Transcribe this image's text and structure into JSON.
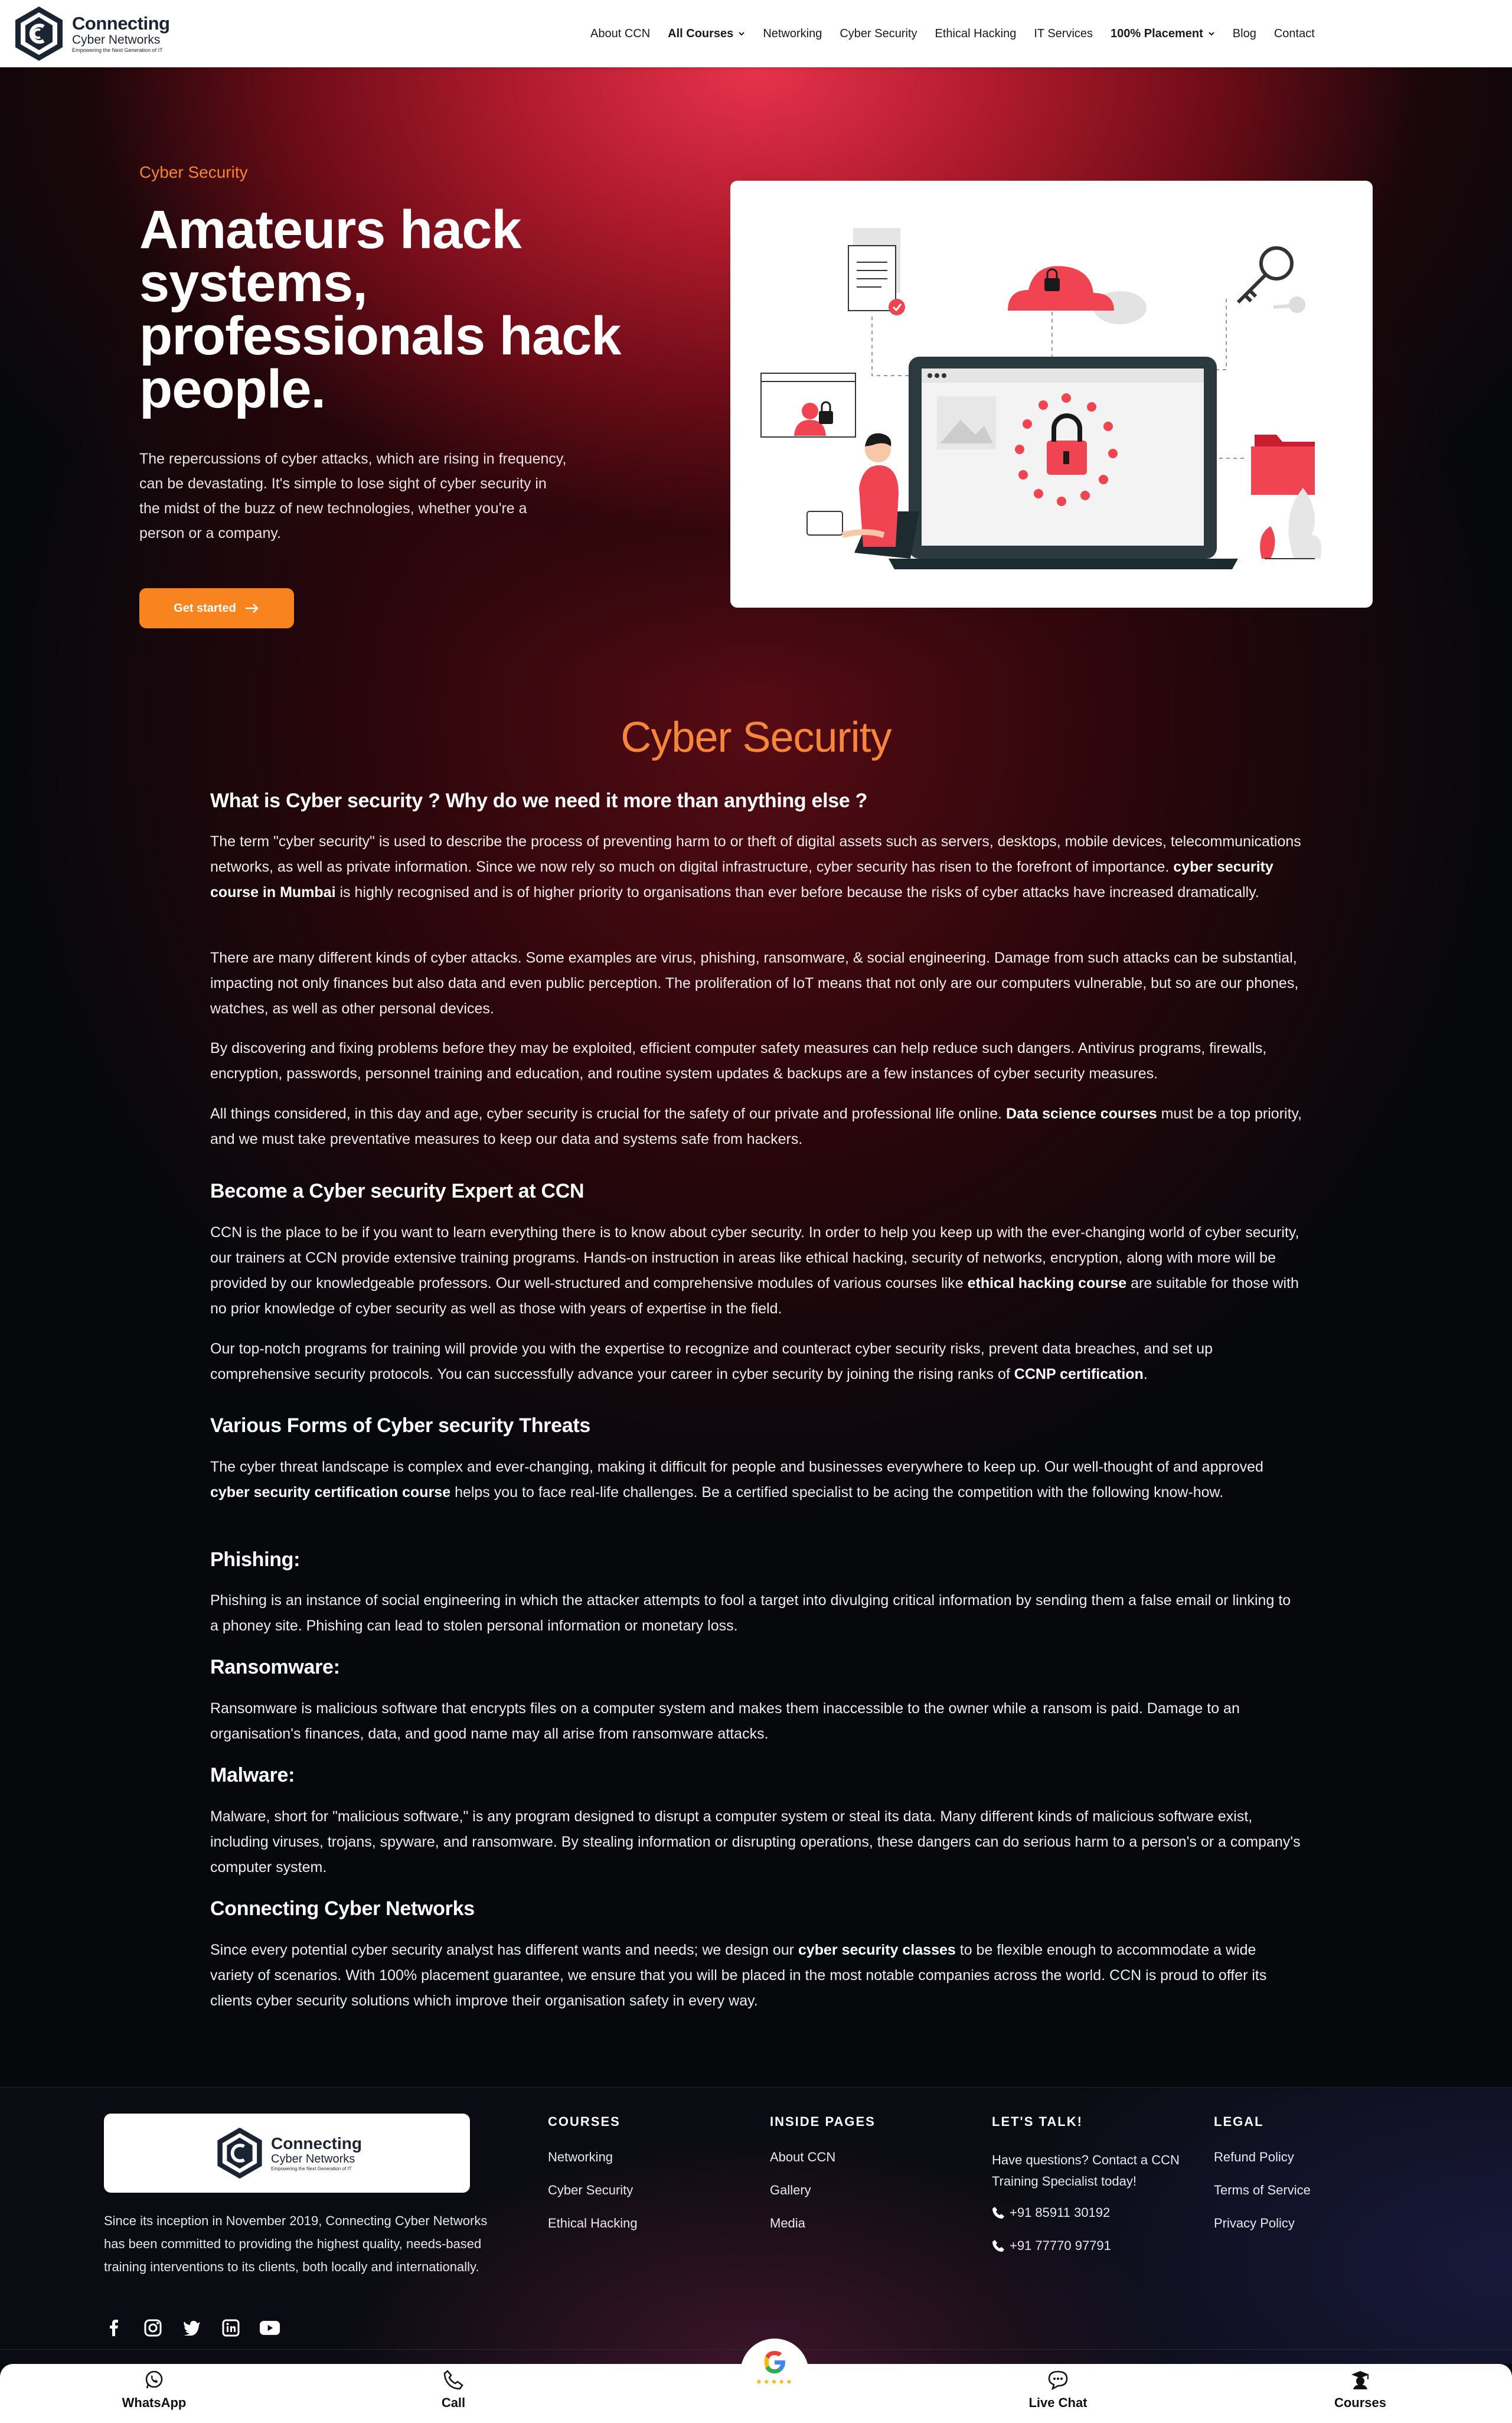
{
  "brand": {
    "title": "Connecting",
    "subtitle": "Cyber Networks",
    "tagline": "Empowering the Next Generation of IT"
  },
  "nav": {
    "items": [
      {
        "label": "About CCN"
      },
      {
        "label": "All Courses"
      },
      {
        "label": "Networking"
      },
      {
        "label": "Cyber Security"
      },
      {
        "label": "Ethical Hacking"
      },
      {
        "label": "IT Services"
      },
      {
        "label": "100% Placement"
      },
      {
        "label": "Blog"
      },
      {
        "label": "Contact"
      }
    ]
  },
  "hero": {
    "eyebrow": "Cyber Security",
    "title": "Amateurs hack systems, professionals hack people.",
    "text": "The repercussions of cyber attacks, which are rising in frequency, can be devastating. It's simple to lose sight of cyber security in the midst of the buzz of new technologies, whether you're a person or a company.",
    "cta": "Get started"
  },
  "article": {
    "title": "Cyber Security",
    "h_what": "What is Cyber security ? Why do we need it more than anything else ?",
    "p1a": "The term \"cyber security\" is used to describe the process of preventing harm to or theft of digital assets such as servers, desktops, mobile devices, telecommunications networks, as well as private information. Since we now rely so much on digital infrastructure, cyber security has risen to the forefront of importance. ",
    "p1b": "cyber security course in Mumbai",
    "p1c": " is highly recognised and is of higher priority to organisations than ever before because the risks of cyber attacks have increased dramatically.",
    "p2": "There are many different kinds of cyber attacks. Some examples are virus, phishing, ransomware, & social engineering. Damage from such attacks can be substantial, impacting not only finances but also data and even public perception. The proliferation of IoT means that not only are our computers vulnerable, but so are our phones, watches, as well as other personal devices.",
    "p3": "By discovering and fixing problems before they may be exploited, efficient computer safety measures can help reduce such dangers. Antivirus programs, firewalls, encryption, passwords, personnel training and education, and routine system updates & backups are a few instances of cyber security measures.",
    "p4a": "All things considered, in this day and age, cyber security is crucial for the safety of our private and professional life online. ",
    "p4b": "Data science courses",
    "p4c": " must be a top priority, and we must take preventative measures to keep our data and systems safe from hackers.",
    "h_expert": "Become a Cyber security Expert at CCN",
    "p5a": "CCN is the place to be if you want to learn everything there is to know about cyber security. In order to help you keep up with the ever-changing world of cyber security, our trainers at CCN provide extensive training programs. Hands-on instruction in areas like ethical hacking, security of networks, encryption, along with more will be provided by our knowledgeable professors. Our well-structured and comprehensive modules of various courses like ",
    "p5b": "ethical hacking course",
    "p5c": " are suitable for those with no prior knowledge of cyber security as well as those with years of expertise in the field.",
    "p6a": "Our top-notch programs for training will provide you with the expertise to recognize and counteract cyber security risks, prevent data breaches, and set up comprehensive security protocols. You can successfully advance your career in cyber security by joining the rising ranks of ",
    "p6b": "CCNP certification",
    "p6c": ".",
    "h_threats": "Various Forms of Cyber security Threats",
    "p7a": "The cyber threat landscape is complex and ever-changing, making it difficult for people and businesses everywhere to keep up. Our well-thought of and approved ",
    "p7b": "cyber security certification course",
    "p7c": " helps you to face real-life challenges. Be a certified specialist to be acing the competition with the following know-how.",
    "h_phishing": "Phishing:",
    "p8": "Phishing is an instance of social engineering in which the attacker attempts to fool a target into divulging critical information by sending them a false email or linking to a phoney site. Phishing can lead to stolen personal information or monetary loss.",
    "h_ransomware": "Ransomware:",
    "p9": "Ransomware is malicious software that encrypts files on a computer system and makes them inaccessible to the owner while a ransom is paid. Damage to an organisation's finances, data, and good name may all arise from ransomware attacks.",
    "h_malware": "Malware:",
    "p10": "Malware, short for \"malicious software,\" is any program designed to disrupt a computer system or steal its data. Many different kinds of malicious software exist, including viruses, trojans, spyware, and ransomware. By stealing information or disrupting operations, these dangers can do serious harm to a person's or a company's computer system.",
    "h_ccn": "Connecting Cyber Networks",
    "p11a": "Since every potential cyber security analyst has different wants and needs; we design our ",
    "p11b": "cyber security classes",
    "p11c": " to be flexible enough to accommodate a wide variety of scenarios. With 100% placement guarantee, we ensure that you will be placed in the most notable companies across the world. CCN is proud to offer its clients cyber security solutions which improve their organisation safety in every way."
  },
  "footer": {
    "about": "Since its inception in November 2019, Connecting Cyber Networks has been committed to providing the highest quality, needs-based training interventions to its clients, both locally and internationally.",
    "courses": {
      "heading": "COURSES",
      "links": [
        "Networking",
        "Cyber Security",
        "Ethical Hacking"
      ]
    },
    "inside": {
      "heading": "INSIDE PAGES",
      "links": [
        "About CCN",
        "Gallery",
        "Media"
      ]
    },
    "talk": {
      "heading": "LET'S TALK!",
      "note": "Have questions? Contact a CCN Training Specialist today!",
      "phones": [
        "+91 85911 30192",
        "+91 77770 97791"
      ]
    },
    "legal": {
      "heading": "LEGAL",
      "links": [
        "Refund Policy",
        "Terms of Service",
        "Privacy Policy"
      ]
    },
    "socials": [
      "facebook-icon",
      "instagram-icon",
      "twitter-icon",
      "linkedin-icon",
      "youtube-icon"
    ]
  },
  "bottom_bar": {
    "whatsapp": "WhatsApp",
    "call": "Call",
    "live_chat": "Live Chat",
    "courses": "Courses"
  },
  "colors": {
    "accent_orange": "#f7841f",
    "title_orange": "#f6873a",
    "hero_red": "#e7334c",
    "illustration_red": "#f04452"
  }
}
